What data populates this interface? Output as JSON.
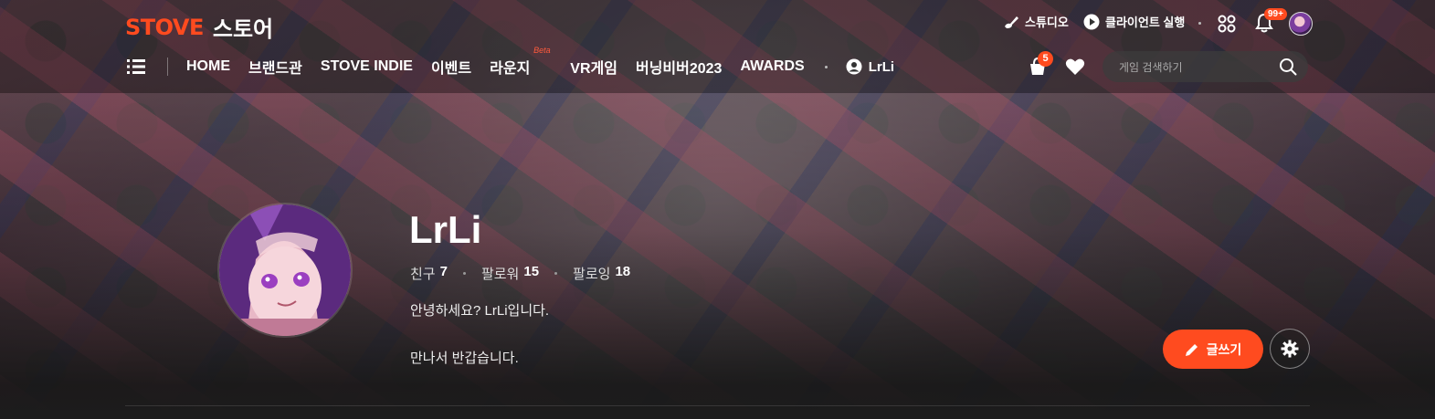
{
  "header": {
    "logo_brand": "STOVE",
    "logo_store": "스토어",
    "studio_label": "스튜디오",
    "client_label": "클라이언트 실행",
    "notification_count": "99+",
    "nav": [
      {
        "label": "HOME"
      },
      {
        "label": "브랜드관"
      },
      {
        "label": "STOVE INDIE"
      },
      {
        "label": "이벤트"
      },
      {
        "label": "라운지",
        "badge": "Beta"
      },
      {
        "label": "VR게임"
      },
      {
        "label": "버닝비버2023"
      },
      {
        "label": "AWARDS"
      }
    ],
    "user_name": "LrLi",
    "cart_count": "5",
    "search_placeholder": "게임 검색하기"
  },
  "profile": {
    "name": "LrLi",
    "stats": [
      {
        "label": "친구",
        "value": "7"
      },
      {
        "label": "팔로워",
        "value": "15"
      },
      {
        "label": "팔로잉",
        "value": "18"
      }
    ],
    "bio_line1": "안녕하세요? LrLi입니다.",
    "bio_line2": "만나서 반갑습니다.",
    "write_label": "글쓰기"
  },
  "colors": {
    "accent": "#ff4b1f",
    "background": "#1c1c1c"
  },
  "icons": [
    "brush-icon",
    "play-icon",
    "grid-icon",
    "bell-icon",
    "menu-icon",
    "user-icon",
    "cart-icon",
    "heart-icon",
    "search-icon",
    "pencil-icon",
    "gear-icon"
  ]
}
